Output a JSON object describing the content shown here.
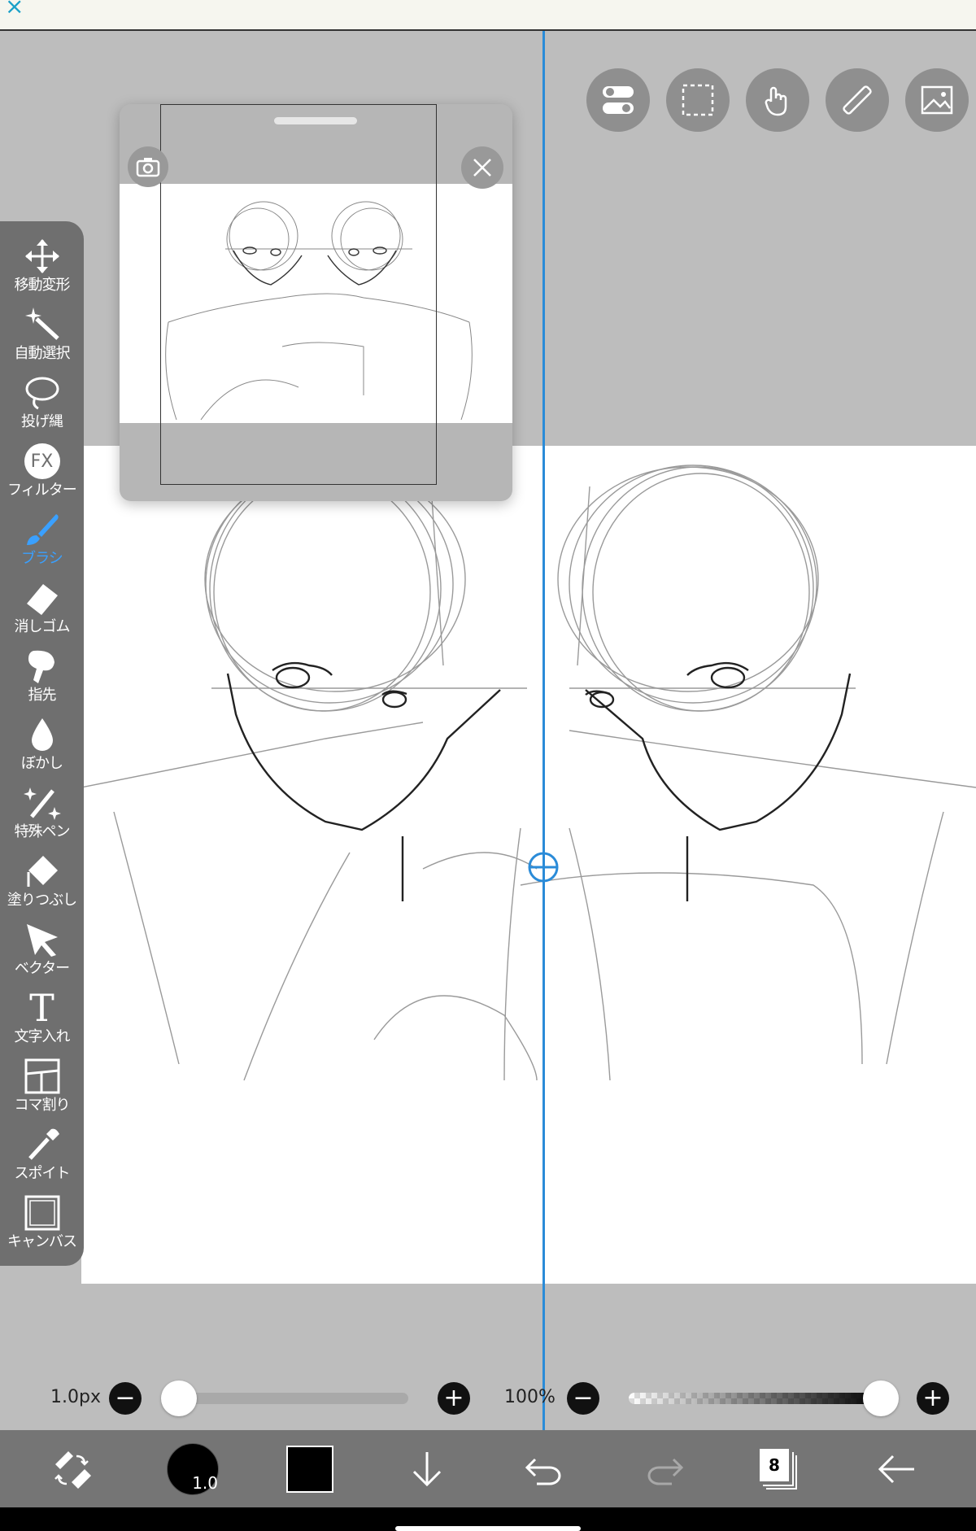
{
  "tools": [
    {
      "id": "move",
      "label": "移動変形",
      "icon": "move-icon"
    },
    {
      "id": "magic",
      "label": "自動選択",
      "icon": "magic-wand-icon"
    },
    {
      "id": "lasso",
      "label": "投げ縄",
      "icon": "lasso-icon"
    },
    {
      "id": "filter",
      "label": "フィルター",
      "icon": "fx-icon",
      "badge": "FX"
    },
    {
      "id": "brush",
      "label": "ブラシ",
      "icon": "brush-icon",
      "active": true
    },
    {
      "id": "eraser",
      "label": "消しゴム",
      "icon": "eraser-icon"
    },
    {
      "id": "finger",
      "label": "指先",
      "icon": "finger-icon"
    },
    {
      "id": "blur",
      "label": "ぼかし",
      "icon": "blur-drop-icon"
    },
    {
      "id": "special",
      "label": "特殊ペン",
      "icon": "special-pen-icon"
    },
    {
      "id": "fill",
      "label": "塗りつぶし",
      "icon": "bucket-icon"
    },
    {
      "id": "vector",
      "label": "ベクター",
      "icon": "vector-arrow-icon"
    },
    {
      "id": "text",
      "label": "文字入れ",
      "icon": "text-icon",
      "badge": "T"
    },
    {
      "id": "frame",
      "label": "コマ割り",
      "icon": "frame-divider-icon"
    },
    {
      "id": "dropper",
      "label": "スポイト",
      "icon": "eyedropper-icon"
    },
    {
      "id": "canvas",
      "label": "キャンバス",
      "icon": "canvas-icon"
    }
  ],
  "brush": {
    "size_label": "1.0px",
    "size_fraction": 0.0,
    "opacity_label": "100%",
    "opacity_fraction": 1.0,
    "size_indicator": "1.0"
  },
  "colors": {
    "current": "#000000",
    "accent": "#2a8bd8",
    "panel": "#6f6f6f",
    "toolbar": "#757575"
  },
  "layers": {
    "count": "8"
  },
  "top_tools": [
    "toggle-icon",
    "selection-icon",
    "hand-icon",
    "ruler-icon",
    "image-icon"
  ],
  "topbar": {
    "close_glyph": "×"
  }
}
